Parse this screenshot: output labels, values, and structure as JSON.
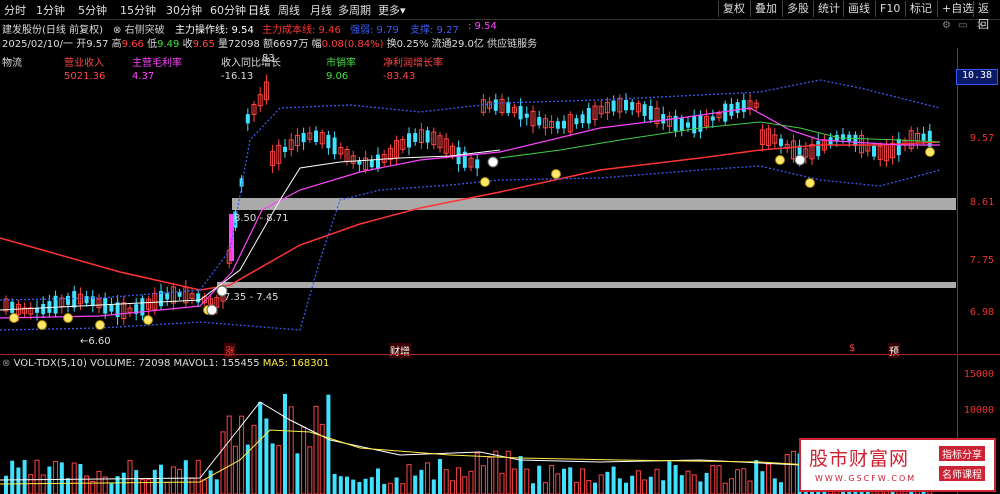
{
  "toolbar": {
    "periods": [
      "分时",
      "1分钟",
      "5分钟",
      "15分钟",
      "30分钟",
      "60分钟",
      "日线",
      "周线",
      "月线",
      "多周期",
      "更多"
    ],
    "right_buttons": [
      "复权",
      "叠加",
      "多股",
      "统计",
      "画线",
      "F10",
      "标记",
      "+自选",
      "返回"
    ]
  },
  "header": {
    "title": "建发股份(日线 前复权)",
    "indicator_name": "右侧突破",
    "main_line_label": "主力操作线: 9.54",
    "cost_line_label": "主力成本线: 9.46",
    "extra1": "强弱: 9.79",
    "extra2": "支撑: 9.27",
    "extra3": ": 9.54",
    "info": {
      "date": "2025/02/10/一",
      "open_label": "开",
      "open": "9.57",
      "high_label": "高",
      "high": "9.66",
      "low_label": "低",
      "low": "9.49",
      "close_label": "收",
      "close": "9.65",
      "vol_label": "量",
      "vol": "72098",
      "amount_label": "额",
      "amount": "6697万",
      "change_label": "幅",
      "change": "0.08(0.84%)",
      "turnover": "换0.25%",
      "float": "流通29.0亿",
      "sector": "供应链服务"
    }
  },
  "fundamentals": {
    "labels": [
      "物流",
      "营业收入",
      "主营毛利率",
      "收入同比增长",
      "市销率",
      "净利润增长率"
    ],
    "values": [
      "5021.36",
      "4.37",
      "-16.13",
      "9.06",
      "-83.43"
    ],
    "extra": "83"
  },
  "price_axis": {
    "ticks": [
      "10.38",
      "9.57",
      "8.61",
      "7.75",
      "6.98"
    ],
    "annotations": [
      "8.50 - 8.71",
      "7.35 - 7.45",
      "6.60"
    ],
    "markers": [
      "涨",
      "财增",
      "$",
      "预"
    ]
  },
  "volume": {
    "label": "VOL-TDX(5,10)",
    "volume": "VOLUME: 72098",
    "mavol1": "MAVOL1: 155455",
    "ma5": "MA5: 168301",
    "ticks": [
      "15000",
      "10000"
    ]
  },
  "watermark": {
    "title": "股市财富网",
    "tag1": "指标分享",
    "tag2": "名师课程",
    "url": "WWW.GSCFW.COM"
  },
  "colors": {
    "up": "#ff4444",
    "down": "#40e0ff",
    "ma_white": "#ffffff",
    "ma_magenta": "#ff44ff",
    "ma_green": "#44cc44",
    "ma_red": "#ff3333",
    "band_blue": "#3a5aee",
    "zone_gray": "#c8c8c8"
  }
}
